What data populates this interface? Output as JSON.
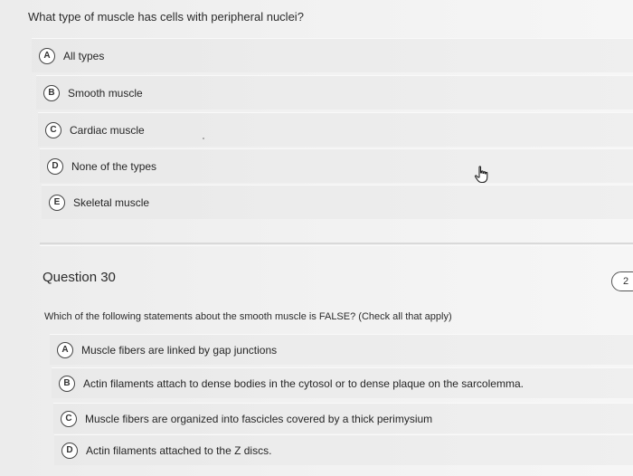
{
  "question1": {
    "text": "What type of muscle has cells with peripheral nuclei?",
    "options": [
      {
        "letter": "A",
        "label": "All types"
      },
      {
        "letter": "B",
        "label": "Smooth muscle"
      },
      {
        "letter": "C",
        "label": "Cardiac muscle"
      },
      {
        "letter": "D",
        "label": "None of the types"
      },
      {
        "letter": "E",
        "label": "Skeletal muscle"
      }
    ]
  },
  "question2": {
    "heading": "Question 30",
    "points": "2",
    "text": "Which of the following statements about the smooth muscle is FALSE? (Check all that apply)",
    "options": [
      {
        "letter": "A",
        "label": "Muscle fibers are linked by gap junctions"
      },
      {
        "letter": "B",
        "label": "Actin filaments attach to dense bodies in the cytosol or to dense plaque on the sarcolemma."
      },
      {
        "letter": "C",
        "label": "Muscle fibers are organized into fascicles covered by a thick perimysium"
      },
      {
        "letter": "D",
        "label": "Actin filaments attached to the Z discs."
      }
    ]
  },
  "icons": {
    "cursor": "hand-pointer-icon"
  }
}
